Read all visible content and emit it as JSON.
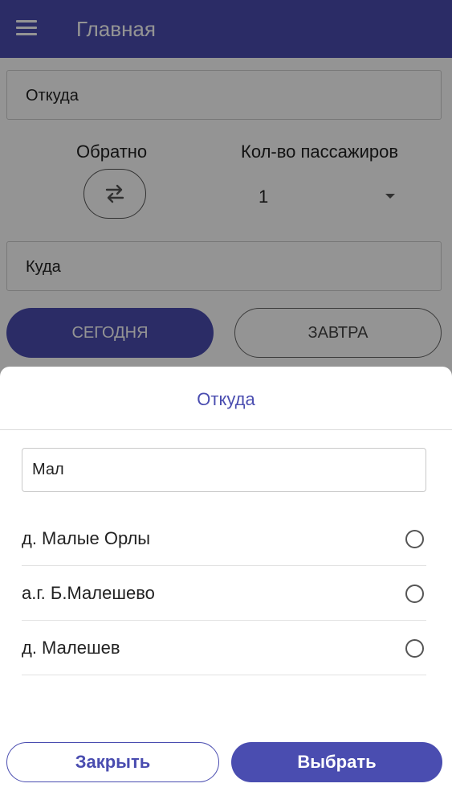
{
  "appbar": {
    "title": "Главная",
    "menu_icon": "menu-icon"
  },
  "form": {
    "from_label": "Откуда",
    "to_label": "Куда",
    "back_label": "Обратно",
    "swap_icon": "swap-arrows-icon",
    "passengers_label": "Кол-во пассажиров",
    "passengers_value": "1",
    "today_label": "СЕГОДНЯ",
    "tomorrow_label": "ЗАВТРА"
  },
  "sheet": {
    "title": "Откуда",
    "search_value": "Мал",
    "items": [
      {
        "label": "д. Малые Орлы"
      },
      {
        "label": "а.г. Б.Малешево"
      },
      {
        "label": "д. Малешев"
      }
    ],
    "close_label": "Закрыть",
    "select_label": "Выбрать"
  },
  "colors": {
    "primary": "#4a4db0",
    "scrim": "rgba(0,0,0,0.42)"
  }
}
